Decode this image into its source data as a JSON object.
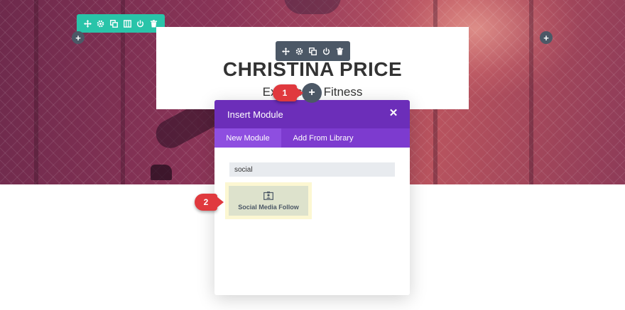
{
  "page": {
    "title": "CHRISTINA PRICE",
    "subtitle": "Exercise & Fitness"
  },
  "row_toolbar": {
    "icons": [
      "move-icon",
      "gear-icon",
      "duplicate-icon",
      "columns-icon",
      "power-icon",
      "trash-icon"
    ]
  },
  "module_toolbar": {
    "icons": [
      "move-icon",
      "gear-icon",
      "duplicate-icon",
      "power-icon",
      "trash-icon"
    ]
  },
  "add_button_symbol": "+",
  "callouts": {
    "one": "1",
    "two": "2"
  },
  "modal": {
    "title": "Insert Module",
    "close_symbol": "✕",
    "tabs": [
      {
        "label": "New Module",
        "active": true
      },
      {
        "label": "Add From Library",
        "active": false
      }
    ],
    "search_value": "social",
    "results": [
      {
        "label": "Social Media Follow",
        "icon": "social-follow-icon"
      }
    ]
  },
  "colors": {
    "row_toolbar": "#29c4a9",
    "module_toolbar": "#4c5866",
    "modal_header": "#6c2eb9",
    "modal_tabs": "#7d3bcf",
    "callout": "#e0393e"
  }
}
